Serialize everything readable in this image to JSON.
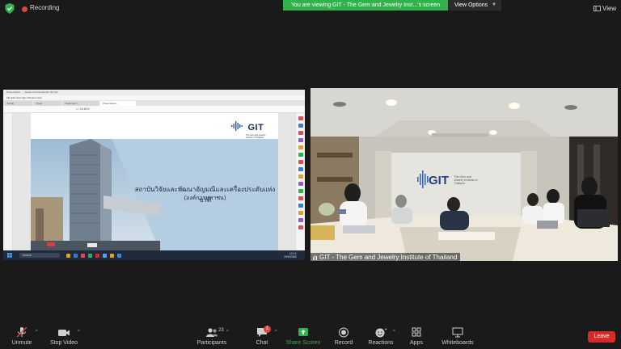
{
  "topbar": {
    "recording_label": "Recording",
    "share_banner": "You are viewing GIT - The Gem and Jewelry Inst...'s screen",
    "view_options_label": "View Options",
    "view_label": "View"
  },
  "shared_screen": {
    "pdf_window_title": "Presentation  ...  - Adobe Acrobat Reader (64-bit)",
    "pdf_menu": "File   Edit   View   Sign   Window   Help",
    "pdf_tabs": [
      "Home",
      "Tools",
      "Document ...",
      "Presentation..."
    ],
    "pdf_toolbar": "1  /  18      82%",
    "slide": {
      "logo_text": "GIT",
      "logo_subtitle": "The Gem and Jewelry Institute of Thailand",
      "thai_title": "สถาบันวิจัยและพัฒนาอัญมณีและเครื่องประดับแห่งชาติ",
      "thai_subtitle": "(องค์การมหาชน)"
    },
    "taskbar": {
      "search_label": "Search",
      "clock_time": "10:14",
      "clock_date": "29/9/2566"
    }
  },
  "camera": {
    "participant_name": "GIT - The Gem and Jewelry Institute of Thailand",
    "wall_logo_text": "GIT",
    "wall_logo_subtitle": "The Gem and Jewelry Institute of Thailand"
  },
  "toolbar": {
    "unmute_label": "Unmute",
    "stop_video_label": "Stop Video",
    "participants_label": "Participants",
    "participants_count": "23",
    "chat_label": "Chat",
    "chat_badge": "1",
    "share_screen_label": "Share Screen",
    "record_label": "Record",
    "reactions_label": "Reactions",
    "apps_label": "Apps",
    "whiteboards_label": "Whiteboards",
    "leave_label": "Leave"
  },
  "colors": {
    "accent_green": "#2fb34a",
    "leave_red": "#d52b2b",
    "background": "#1a1a1a"
  }
}
